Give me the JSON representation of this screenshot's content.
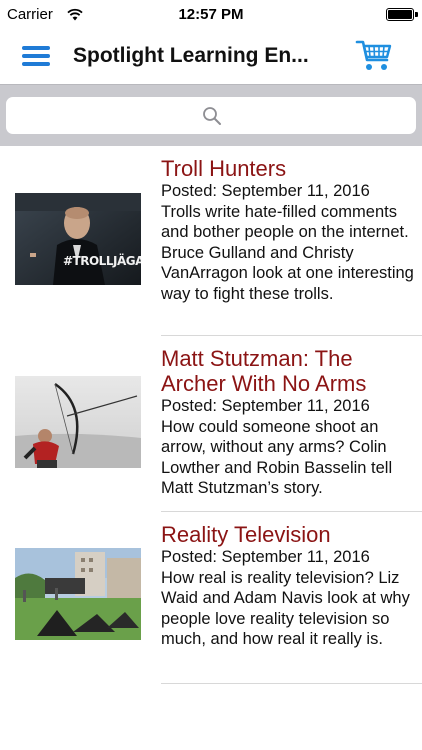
{
  "status_bar": {
    "carrier": "Carrier",
    "time": "12:57 PM",
    "wifi_icon": "wifi-icon",
    "battery_icon": "battery-icon",
    "battery_level": 1.0
  },
  "nav": {
    "title": "Spotlight Learning En...",
    "menu_icon": "hamburger-menu-icon",
    "cart_icon": "shopping-cart-icon"
  },
  "search": {
    "placeholder": "",
    "icon": "search-icon"
  },
  "articles": [
    {
      "title": "Troll Hunters",
      "date": "Posted: September 11, 2016",
      "summary": "Trolls write hate-filled comments and bother people on the internet. Bruce Gulland and Christy VanArragon look at one interesting way to fight these trolls.",
      "image_caption": "#TROLLJÄGAR"
    },
    {
      "title": "Matt Stutzman: The Archer With No Arms",
      "date": "Posted: September 11, 2016",
      "summary": "How could someone shoot an arrow, without any arms? Colin Lowther and Robin Basselin tell Matt Stutzman’s story."
    },
    {
      "title": "Reality Television",
      "date": "Posted: September 11, 2016",
      "summary": "How real is reality television? Liz Waid and Adam Navis look at why people love reality television so much, and how real it really is."
    }
  ],
  "colors": {
    "accent": "#1f7bd6",
    "title": "#8b1414",
    "search_bg": "#c9c9ce"
  }
}
